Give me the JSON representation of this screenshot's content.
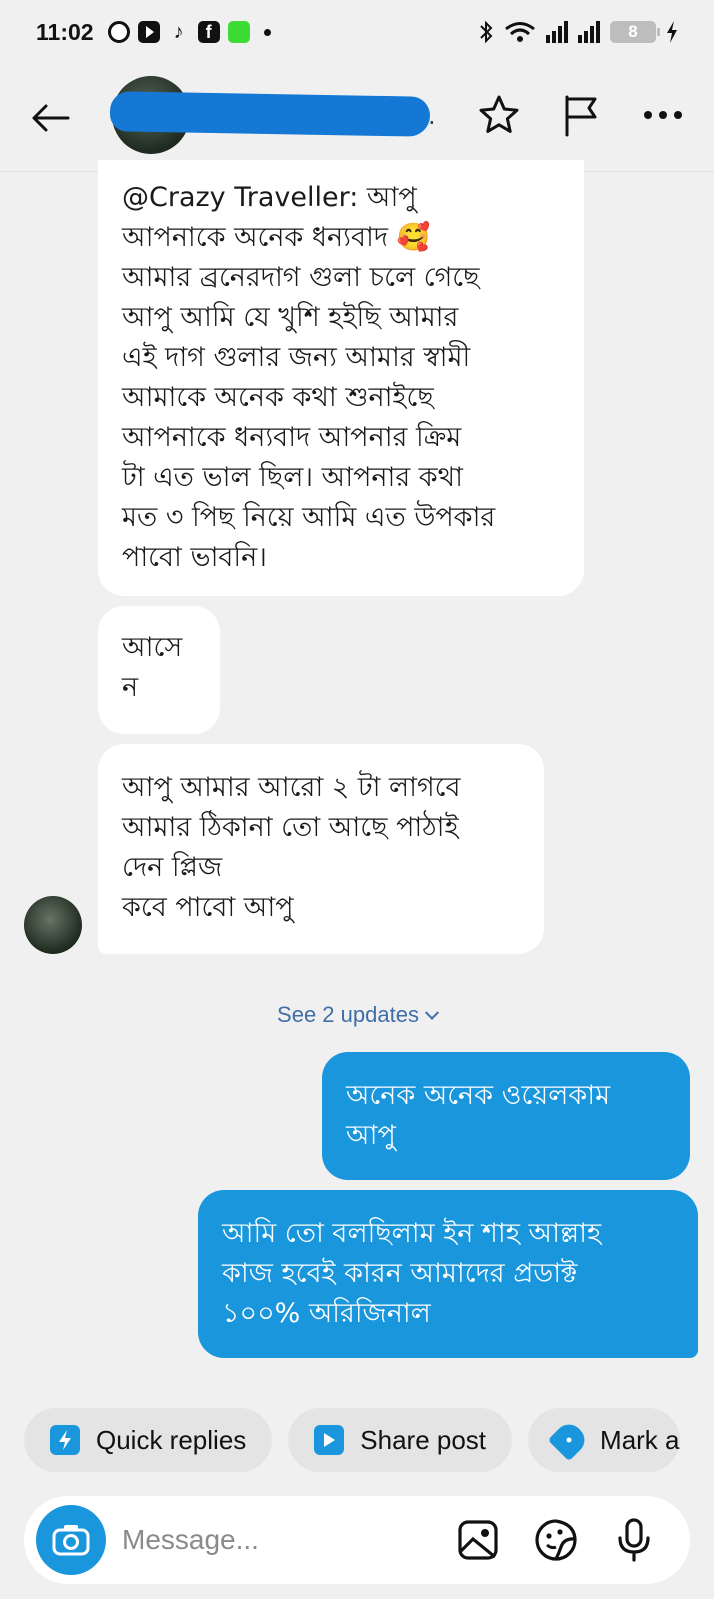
{
  "status_bar": {
    "time": "11:02",
    "battery": "8"
  },
  "header": {
    "contact_name_visible": "."
  },
  "messages": [
    {
      "direction": "in",
      "text": "@Crazy Traveller: আপু\nআপনাকে অনেক ধন্যবাদ 🥰\nআমার ব্রনেরদাগ গুলা চলে গেছে\nআপু আমি যে খুশি হইছি আমার\nএই দাগ গুলার জন্য আমার স্বামী\nআমাকে অনেক কথা শুনাইছে\nআপনাকে ধন্যবাদ আপনার ক্রিম\nটা এত ভাল ছিল। আপনার কথা\nমত ৩ পিছ নিয়ে আমি এত উপকার\nপাবো ভাবনি।"
    },
    {
      "direction": "in",
      "text": "আসে\nন"
    },
    {
      "direction": "in",
      "text": "আপু আমার আরো ২ টা লাগবে\nআমার ঠিকানা তো আছে পাঠাই\nদেন প্লিজ\nকবে পাবো আপু"
    },
    {
      "direction": "out",
      "text": "অনেক অনেক ওয়েলকাম\nআপু"
    },
    {
      "direction": "out",
      "text": "আমি তো বলছিলাম ইন শাহ আল্লাহ\nকাজ হবেই কারন আমাদের প্রডাক্ট\n১০০% অরিজিনাল"
    }
  ],
  "see_updates": "See 2 updates",
  "quick_actions": [
    {
      "label": "Quick replies",
      "icon": "lightning-icon"
    },
    {
      "label": "Share post",
      "icon": "play-icon"
    },
    {
      "label": "Mark a",
      "icon": "tag-icon"
    }
  ],
  "composer": {
    "placeholder": "Message..."
  },
  "colors": {
    "accent": "#1a96dc",
    "background": "#f0f0f0",
    "incoming_bubble": "#ffffff",
    "link": "#3f6fa8"
  }
}
